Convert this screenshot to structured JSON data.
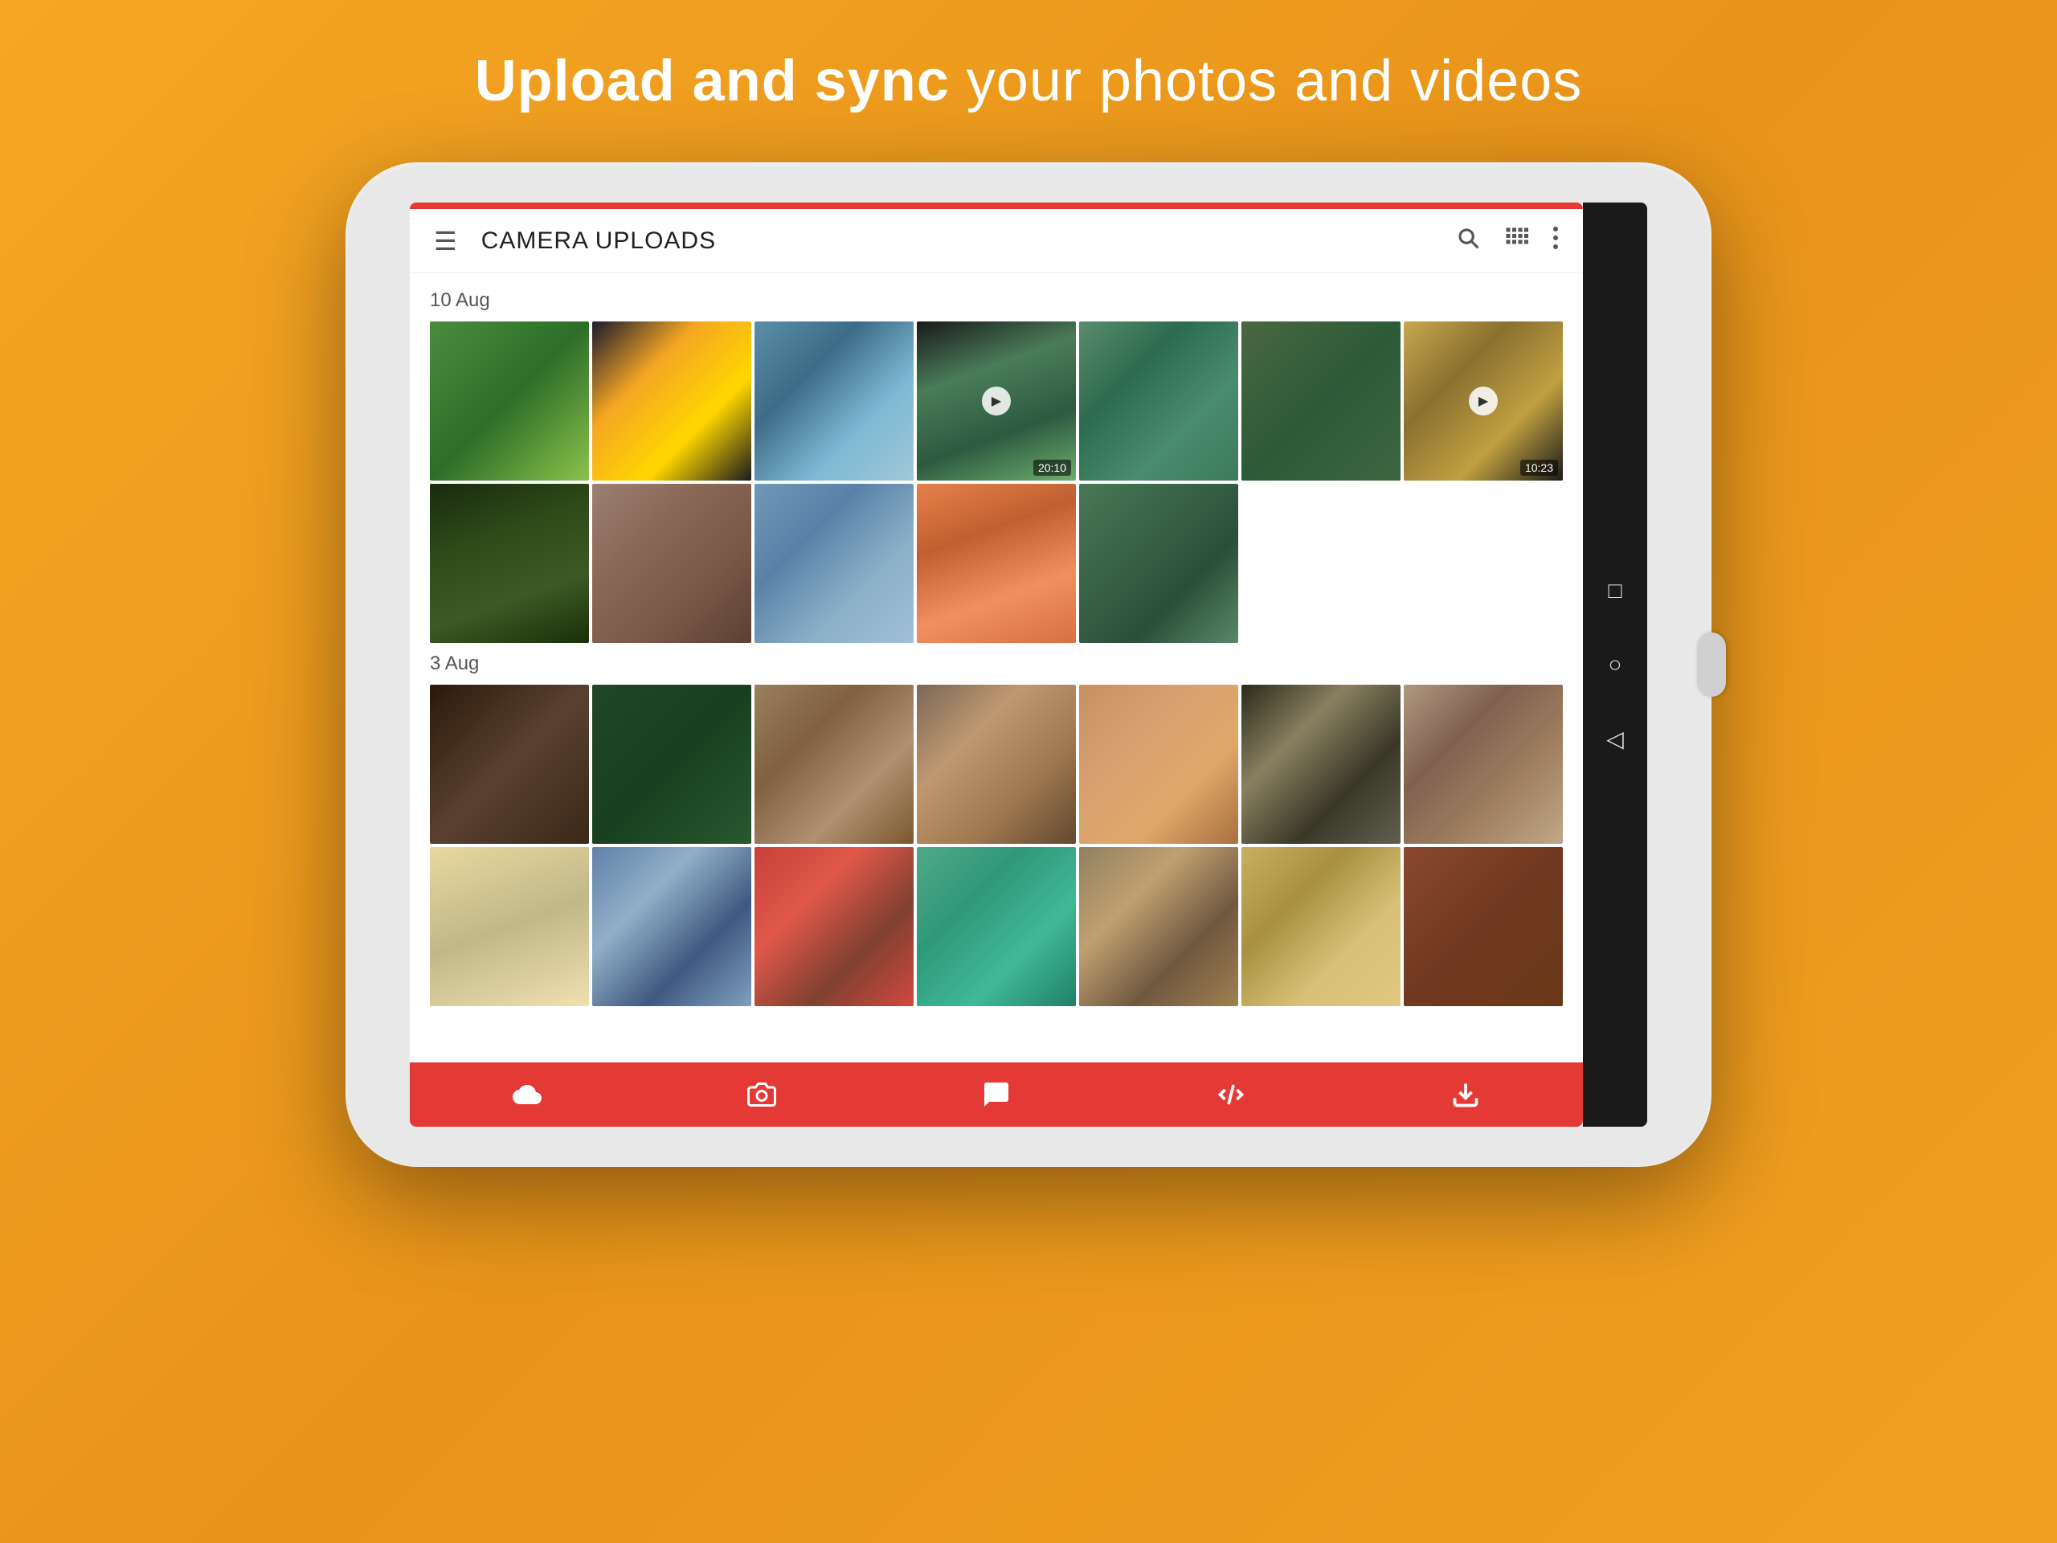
{
  "headline": {
    "prefix": "Upload and sync",
    "suffix": " your photos and videos"
  },
  "toolbar": {
    "title": "CAMERA UPLOADS",
    "menu_label": "menu",
    "search_label": "search",
    "grid_label": "grid view",
    "more_label": "more options"
  },
  "sections": [
    {
      "date": "10 Aug",
      "rows": [
        [
          {
            "id": "p1",
            "type": "photo"
          },
          {
            "id": "p2",
            "type": "photo"
          },
          {
            "id": "p3",
            "type": "photo"
          },
          {
            "id": "p4",
            "type": "video",
            "duration": "20:10"
          },
          {
            "id": "p5",
            "type": "photo"
          },
          {
            "id": "p6",
            "type": "photo"
          },
          {
            "id": "p7",
            "type": "video",
            "duration": "10:23"
          }
        ],
        [
          {
            "id": "p8",
            "type": "photo"
          },
          {
            "id": "p9",
            "type": "photo"
          },
          {
            "id": "p10",
            "type": "photo"
          },
          {
            "id": "p11",
            "type": "photo"
          },
          {
            "id": "p12",
            "type": "photo"
          },
          {
            "id": "empty",
            "type": "empty"
          },
          {
            "id": "empty2",
            "type": "empty"
          }
        ]
      ]
    },
    {
      "date": "3 Aug",
      "rows": [
        [
          {
            "id": "p13",
            "type": "photo"
          },
          {
            "id": "p14",
            "type": "photo"
          },
          {
            "id": "p15",
            "type": "photo"
          },
          {
            "id": "p16",
            "type": "photo"
          },
          {
            "id": "p17",
            "type": "photo"
          },
          {
            "id": "p18",
            "type": "photo"
          },
          {
            "id": "p19",
            "type": "photo"
          }
        ],
        [
          {
            "id": "p20",
            "type": "photo"
          },
          {
            "id": "p21",
            "type": "photo"
          },
          {
            "id": "p22",
            "type": "photo"
          },
          {
            "id": "p23",
            "type": "photo"
          },
          {
            "id": "p24",
            "type": "photo"
          },
          {
            "id": "p25",
            "type": "photo"
          },
          {
            "id": "p26",
            "type": "photo"
          }
        ]
      ]
    }
  ],
  "bottom_nav": {
    "items": [
      {
        "icon": "cloud",
        "unicode": "☁"
      },
      {
        "icon": "camera",
        "unicode": "📷"
      },
      {
        "icon": "chat",
        "unicode": "💬"
      },
      {
        "icon": "transfer",
        "unicode": "↔"
      },
      {
        "icon": "download",
        "unicode": "⬇"
      }
    ]
  },
  "android_nav": {
    "square": "□",
    "circle": "○",
    "triangle": "◁"
  }
}
